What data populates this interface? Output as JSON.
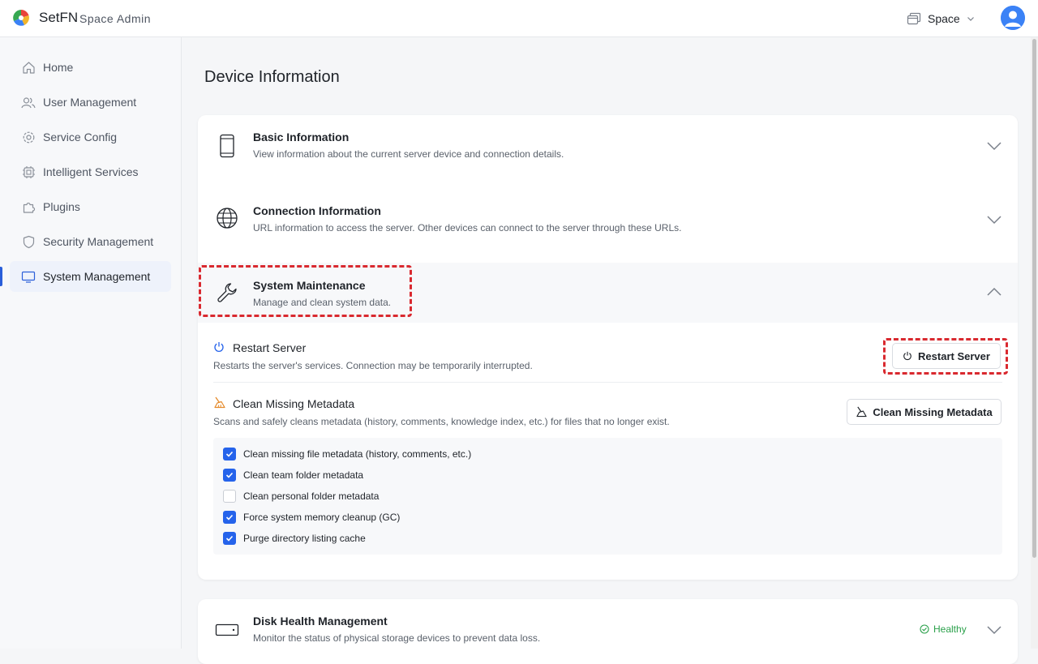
{
  "header": {
    "brand": "SetFN",
    "subtitle": "Space Admin",
    "space_label": "Space"
  },
  "sidebar": {
    "items": [
      {
        "label": "Home",
        "icon": "home-icon"
      },
      {
        "label": "User Management",
        "icon": "users-icon"
      },
      {
        "label": "Service Config",
        "icon": "gear-icon"
      },
      {
        "label": "Intelligent Services",
        "icon": "chip-icon"
      },
      {
        "label": "Plugins",
        "icon": "puzzle-icon"
      },
      {
        "label": "Security Management",
        "icon": "shield-icon"
      },
      {
        "label": "System Management",
        "icon": "monitor-icon",
        "active": true
      }
    ]
  },
  "main": {
    "title": "Device Information",
    "sections": {
      "basic": {
        "title": "Basic Information",
        "desc": "View information about the current server device and connection details."
      },
      "connection": {
        "title": "Connection Information",
        "desc": "URL information to access the server. Other devices can connect to the server through these URLs."
      },
      "maintenance": {
        "title": "System Maintenance",
        "desc": "Manage and clean system data.",
        "restart": {
          "title": "Restart Server",
          "desc": "Restarts the server's services. Connection may be temporarily interrupted.",
          "button": "Restart Server"
        },
        "clean": {
          "title": "Clean Missing Metadata",
          "desc": "Scans and safely cleans metadata (history, comments, knowledge index, etc.) for files that no longer exist.",
          "button": "Clean Missing Metadata",
          "options": [
            {
              "label": "Clean missing file metadata (history, comments, etc.)",
              "checked": true
            },
            {
              "label": "Clean team folder metadata",
              "checked": true
            },
            {
              "label": "Clean personal folder metadata",
              "checked": false
            },
            {
              "label": "Force system memory cleanup (GC)",
              "checked": true
            },
            {
              "label": "Purge directory listing cache",
              "checked": true
            }
          ]
        }
      },
      "disk": {
        "title": "Disk Health Management",
        "desc": "Monitor the status of physical storage devices to prevent data loss.",
        "status": "Healthy"
      }
    }
  },
  "colors": {
    "accent": "#2563eb",
    "highlight": "#d9292f",
    "healthy": "#2aa04a"
  }
}
